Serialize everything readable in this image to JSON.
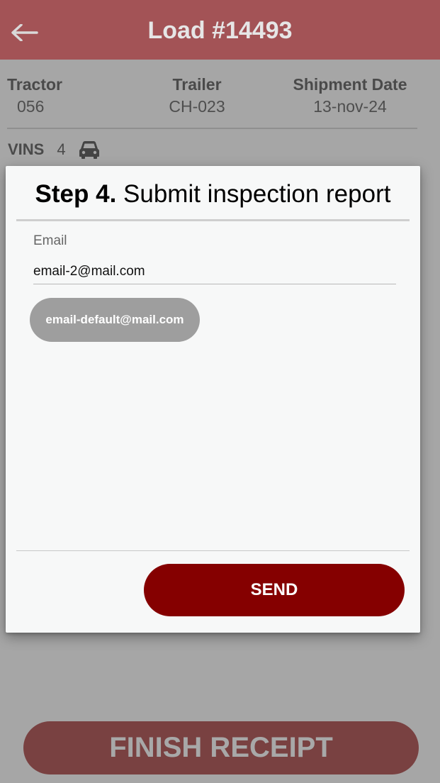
{
  "header": {
    "back_icon": "arrow-left-icon",
    "title": "Load #14493"
  },
  "load_info": {
    "tractor_label": "Tractor",
    "tractor_value": "056",
    "trailer_label": "Trailer",
    "trailer_value": "CH-023",
    "shipment_date_label": "Shipment Date",
    "shipment_date_value": "13-nov-24"
  },
  "vins": {
    "label": "VINS",
    "count": "4",
    "icon": "car-icon"
  },
  "footer": {
    "finish_label": "FINISH RECEIPT"
  },
  "modal": {
    "step": "Step 4.",
    "title": "Submit inspection report",
    "email_label": "Email",
    "email_value": "email-2@mail.com",
    "suggestion_chip": "email-default@mail.com",
    "send_label": "SEND"
  },
  "colors": {
    "header_bg": "#a35356",
    "overlay_bg": "#a6a6a6",
    "send_button": "#850000",
    "finish_button": "#794141",
    "chip_bg": "#9e9e9e",
    "modal_bg": "#f7f8f8"
  }
}
